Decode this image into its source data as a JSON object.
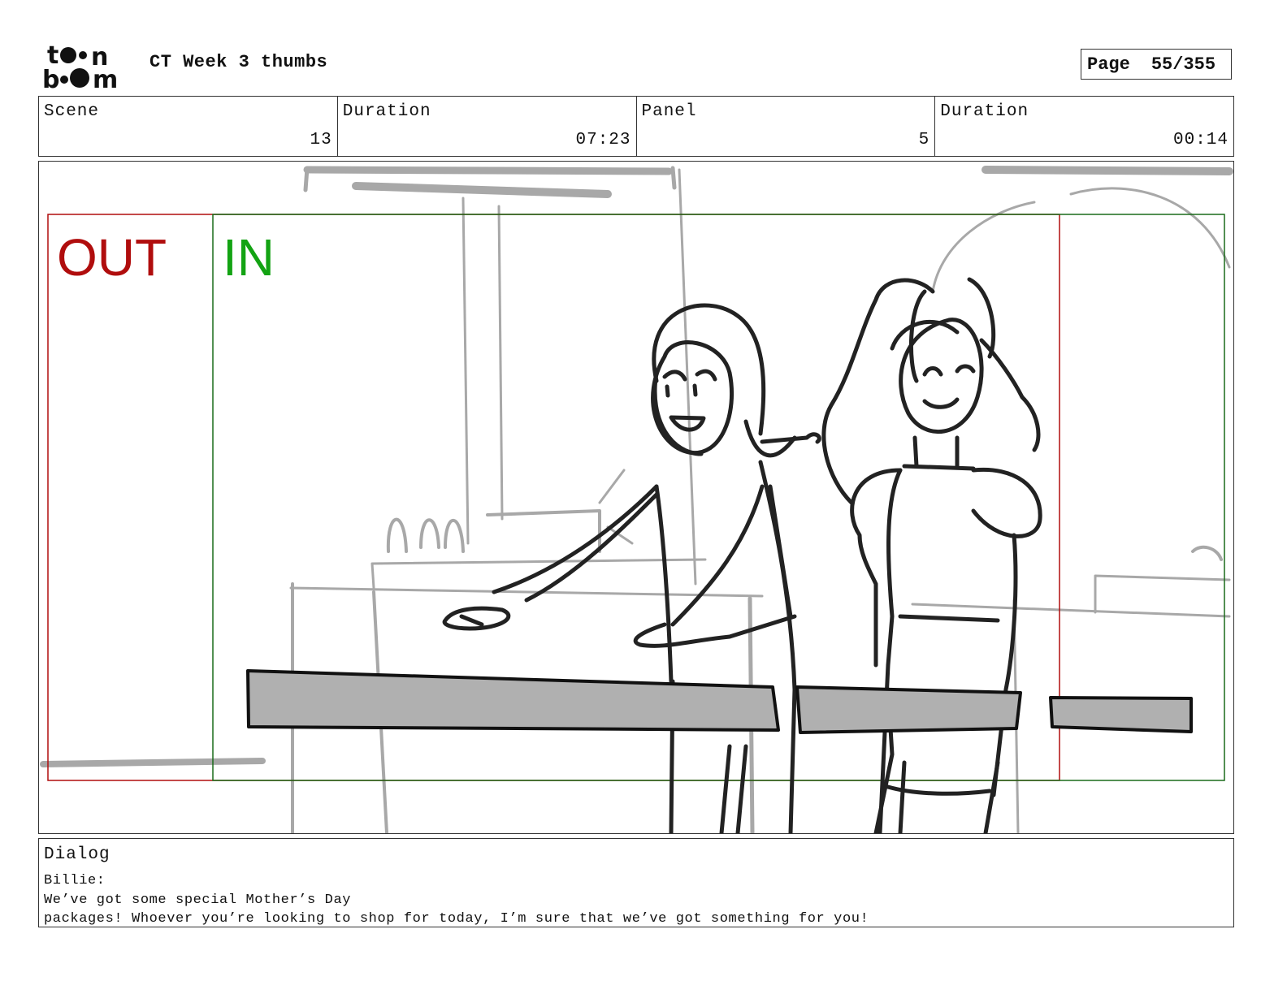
{
  "header": {
    "logo_text": "toon boom",
    "title": "CT Week 3 thumbs",
    "page_label": "Page",
    "page_value": "55/355"
  },
  "info": [
    {
      "label": "Scene",
      "value": "13"
    },
    {
      "label": "Duration",
      "value": "07:23"
    },
    {
      "label": "Panel",
      "value": "5"
    },
    {
      "label": "Duration",
      "value": "00:14"
    }
  ],
  "panel": {
    "out_label": "OUT",
    "in_label": "IN",
    "colors": {
      "out": "#b00d0d",
      "in": "#13a313",
      "sketch_dark": "#222222",
      "sketch_light": "#a8a8a8",
      "counter_fill": "#b0b0b0"
    }
  },
  "dialog": {
    "label": "Dialog",
    "speaker": "Billie:",
    "line1": "We’ve got some special Mother’s Day",
    "line2": "packages! Whoever you’re looking to shop for today, I’m sure that we’ve got something for you!"
  }
}
